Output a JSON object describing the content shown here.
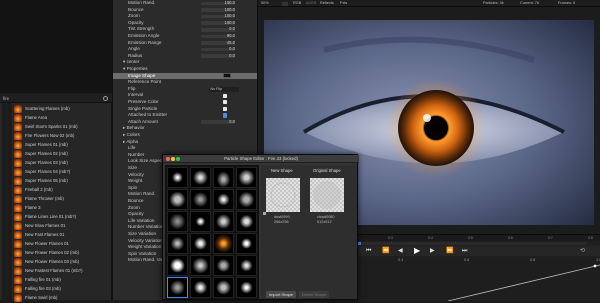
{
  "toolbar": {
    "zoom": "50%",
    "channels": [
      "RGB",
      "ACES"
    ],
    "reflections": "Reflects",
    "fx": "Fxts",
    "particles": "Particles: 3k",
    "current": "Current: 76",
    "frames": "Frames: 5"
  },
  "properties": {
    "rows": [
      {
        "label": "Motion Rand.",
        "value": "100.0",
        "type": "value"
      },
      {
        "label": "Bounce",
        "value": "100.0",
        "type": "value"
      },
      {
        "label": "Zoom",
        "value": "100.0",
        "type": "value"
      },
      {
        "label": "Opacity",
        "value": "100.0",
        "type": "value"
      },
      {
        "label": "Tint Strength",
        "value": "0.0",
        "type": "value"
      },
      {
        "label": "Emission Angle",
        "value": "90.0",
        "type": "value"
      },
      {
        "label": "Emission Range",
        "value": "45.0",
        "type": "value"
      },
      {
        "label": "Angle",
        "value": "0.0",
        "type": "value"
      },
      {
        "label": "Radius",
        "value": "0.0",
        "type": "value"
      },
      {
        "label": "▾ center",
        "value": "",
        "type": "group"
      },
      {
        "label": "▾ Properties",
        "value": "",
        "type": "group"
      },
      {
        "label": "Image Shape",
        "value": "",
        "type": "swatch",
        "selected": true
      },
      {
        "label": "Reference Point",
        "value": "",
        "type": "plain"
      },
      {
        "label": "Flip",
        "value": "No Flip",
        "type": "dropdown"
      },
      {
        "label": "Interval",
        "value": "",
        "type": "check"
      },
      {
        "label": "Preserve Color",
        "value": "",
        "type": "check"
      },
      {
        "label": "Single Particle",
        "value": "",
        "type": "check"
      },
      {
        "label": "Attached to Emitter",
        "value": "",
        "type": "checkblue"
      },
      {
        "label": "Attach Amount",
        "value": "0.0",
        "type": "value"
      },
      {
        "label": "▸ Behavior",
        "value": "",
        "type": "group"
      },
      {
        "label": "▸ Colors",
        "value": "",
        "type": "group"
      },
      {
        "label": "▸ Alpha",
        "value": "",
        "type": "group"
      },
      {
        "label": "Life",
        "value": "",
        "type": "plain"
      },
      {
        "label": "Number",
        "value": "",
        "type": "plain"
      },
      {
        "label": "Look Size Aspect",
        "value": "",
        "type": "plain"
      },
      {
        "label": "Size",
        "value": "",
        "type": "plain"
      },
      {
        "label": "Velocity",
        "value": "",
        "type": "plain"
      },
      {
        "label": "Weight",
        "value": "",
        "type": "plain"
      },
      {
        "label": "Spin",
        "value": "",
        "type": "plain"
      },
      {
        "label": "Motion Rand.",
        "value": "",
        "type": "plain"
      },
      {
        "label": "Bounce",
        "value": "",
        "type": "plain"
      },
      {
        "label": "Zoom",
        "value": "",
        "type": "plain"
      },
      {
        "label": "Opacity",
        "value": "",
        "type": "plain"
      },
      {
        "label": "Life Variation",
        "value": "",
        "type": "plain"
      },
      {
        "label": "Number Variation",
        "value": "",
        "type": "plain"
      },
      {
        "label": "Size Variation",
        "value": "",
        "type": "plain"
      },
      {
        "label": "Velocity Variation",
        "value": "",
        "type": "plain"
      },
      {
        "label": "Weight Variation",
        "value": "",
        "type": "plain"
      },
      {
        "label": "Spin Variation",
        "value": "",
        "type": "plain"
      },
      {
        "label": "Motion Rand. Var.",
        "value": "",
        "type": "plain"
      }
    ]
  },
  "library": {
    "root": "fire",
    "items": [
      "Scattering Flames (mb)",
      "Flame Area",
      "Swirl Storm Sparks 01 (mb)",
      "Fire Flowers Now 02 (mb)",
      "Super Flames 01 (mb)",
      "Super Flames 02 (mb)",
      "Super Flames 03 (mb)",
      "Super Flames 04 (mb?)",
      "Super Flames 05 (mb)",
      "Fireball 2 (mb)",
      "Flame Thrower (mb)",
      "Flame 3",
      "Flame Lines Line 01 (mb?)",
      "New Slow Flames 01",
      "New Fast Flames 01",
      "New Flower Flames 01",
      "New Flower Flames 02 (mb)",
      "New Flower Flames 03 (mb)",
      "New Fastest Flames 01 (mb?)",
      "Falling fire 01 (mb)",
      "Falling fire 03 (mb)",
      "Flame Swirl (mb)"
    ]
  },
  "dialog": {
    "title": "Particle Shape Editor : Fire.33 (locked)",
    "new_shape_label": "New Shape",
    "original_shape_label": "Original Shape",
    "new_shape_caption_1": "dust0999",
    "new_shape_caption_2": "256x256",
    "original_shape_caption_1": "cloud0080",
    "original_shape_caption_2": "512x512",
    "import_label": "Import Shape",
    "delete_label": "Delete Shape"
  },
  "timeline": {
    "ticks": [
      "0",
      "0.2",
      "0.4",
      "0.6",
      "0.8",
      "1.0"
    ],
    "ruler": [
      "0:0",
      "0:1",
      "0:2",
      "0:3",
      "0:4",
      "0:5",
      "0:6",
      "0:7",
      "0:8"
    ]
  },
  "colors": {
    "accent": "#3f8cff",
    "selected_row": "#6c6c6c"
  }
}
